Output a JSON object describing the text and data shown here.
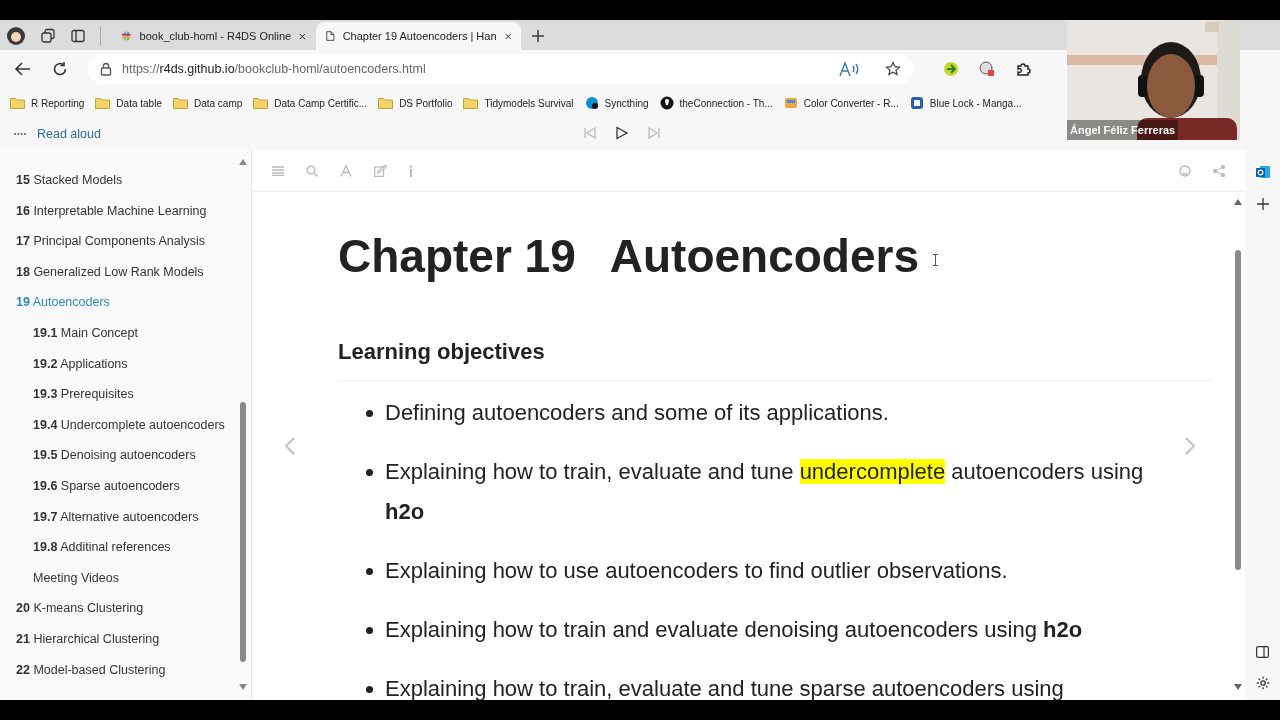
{
  "tabs": [
    {
      "title": "book_club-homl - R4DS Online",
      "kind": "slack",
      "selected": false
    },
    {
      "title": "Chapter 19 Autoencoders | Han",
      "kind": "page",
      "selected": true
    }
  ],
  "address_bar": {
    "url_scheme": "https://",
    "url_host": "r4ds.github.io",
    "url_path": "/bookclub-homl/autoencoders.html"
  },
  "bookmarks": [
    {
      "label": "R Reporting",
      "kind": "folder"
    },
    {
      "label": "Data table",
      "kind": "folder"
    },
    {
      "label": "Data camp",
      "kind": "folder"
    },
    {
      "label": "Data Camp Certific...",
      "kind": "folder"
    },
    {
      "label": "DS Portfolio",
      "kind": "folder"
    },
    {
      "label": "Tidymodels Survival",
      "kind": "folder"
    },
    {
      "label": "Syncthing",
      "kind": "site"
    },
    {
      "label": "theConnection - Th...",
      "kind": "site"
    },
    {
      "label": "Color Converter - R...",
      "kind": "site"
    },
    {
      "label": "Blue Lock - Manga...",
      "kind": "site"
    }
  ],
  "read_aloud": {
    "label": "Read aloud"
  },
  "webcam": {
    "name": "Ángel Féliz Ferreras"
  },
  "sidebar": {
    "items": [
      {
        "number": "15",
        "label": "Stacked Models",
        "selected": false
      },
      {
        "number": "16",
        "label": "Interpretable Machine Learning",
        "selected": false
      },
      {
        "number": "17",
        "label": "Principal Components Analysis",
        "selected": false
      },
      {
        "number": "18",
        "label": "Generalized Low Rank Models",
        "selected": false
      },
      {
        "number": "19",
        "label": "Autoencoders",
        "selected": true,
        "children": [
          {
            "number": "19.1",
            "label": "Main Concept",
            "selected": false
          },
          {
            "number": "19.2",
            "label": "Applications",
            "selected": false
          },
          {
            "number": "19.3",
            "label": "Prerequisites",
            "selected": false
          },
          {
            "number": "19.4",
            "label": "Undercomplete autoencoders",
            "selected": false
          },
          {
            "number": "19.5",
            "label": "Denoising autoencoders",
            "selected": false
          },
          {
            "number": "19.6",
            "label": "Sparse autoencoders",
            "selected": false
          },
          {
            "number": "19.7",
            "label": "Alternative autoencoders",
            "selected": false
          },
          {
            "number": "19.8",
            "label": "Additinal references",
            "selected": false
          },
          {
            "label": "Meeting Videos",
            "selected": false
          }
        ]
      },
      {
        "number": "20",
        "label": "K-means Clustering",
        "selected": false
      },
      {
        "number": "21",
        "label": "Hierarchical Clustering",
        "selected": false
      },
      {
        "number": "22",
        "label": "Model-based Clustering",
        "selected": false
      }
    ]
  },
  "article": {
    "chapter_number": "Chapter 19",
    "chapter_title": "Autoencoders",
    "section_heading": "Learning objectives",
    "bullets": [
      {
        "segments": [
          {
            "text": "Defining autoencoders and some of its applications."
          }
        ]
      },
      {
        "segments": [
          {
            "text": "Explaining how to train, evaluate and tune "
          },
          {
            "text": "undercomplete",
            "highlighted": true
          },
          {
            "text": " autoencoders using "
          },
          {
            "text": "h2o",
            "bold": true
          }
        ]
      },
      {
        "segments": [
          {
            "text": "Explaining how to use autoencoders to find outlier observations."
          }
        ]
      },
      {
        "segments": [
          {
            "text": "Explaining how to train and evaluate denoising autoencoders using "
          },
          {
            "text": "h2o",
            "bold": true
          }
        ]
      },
      {
        "segments": [
          {
            "text": "Explaining how to train, evaluate and tune sparse autoencoders using"
          }
        ]
      }
    ]
  }
}
